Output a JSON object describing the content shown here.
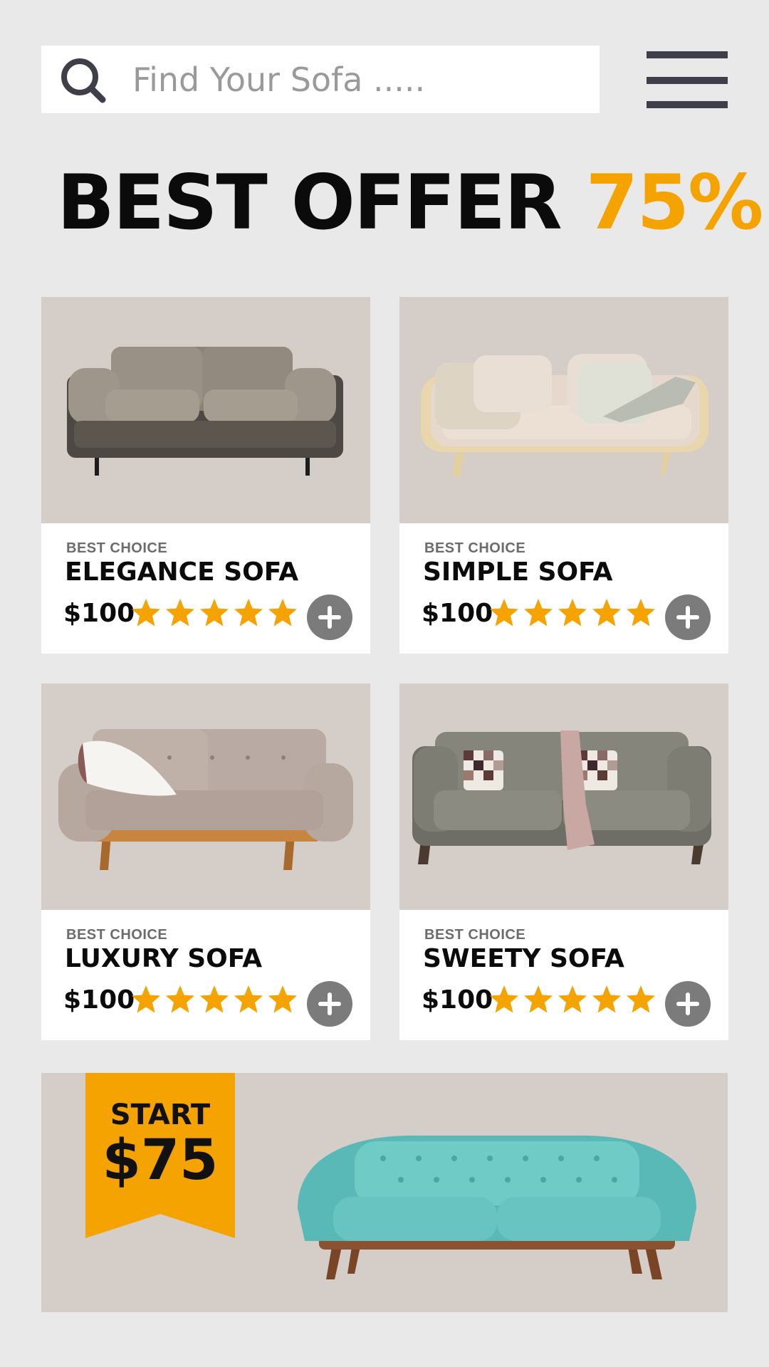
{
  "search": {
    "placeholder": "Find Your Sofa ....."
  },
  "headline": {
    "main": "BEST OFFER",
    "accent": "75%"
  },
  "products": [
    {
      "eyebrow": "BEST CHOICE",
      "name": "ELEGANCE SOFA",
      "price": "$100",
      "rating": 5
    },
    {
      "eyebrow": "BEST CHOICE",
      "name": "SIMPLE SOFA",
      "price": "$100",
      "rating": 5
    },
    {
      "eyebrow": "BEST CHOICE",
      "name": "LUXURY SOFA",
      "price": "$100",
      "rating": 5
    },
    {
      "eyebrow": "BEST CHOICE",
      "name": "SWEETY SOFA",
      "price": "$100",
      "rating": 5
    }
  ],
  "promo": {
    "label": "START",
    "price": "$75"
  },
  "colors": {
    "accent": "#f5a300",
    "background": "#e9e9e9",
    "image_bg": "#d4cdc8",
    "add_button": "#7b7b7b",
    "menu": "#3f3f4a"
  },
  "icons": {
    "search": "search-icon",
    "menu": "hamburger-menu-icon",
    "add": "plus-icon",
    "rating": "star-icon"
  }
}
